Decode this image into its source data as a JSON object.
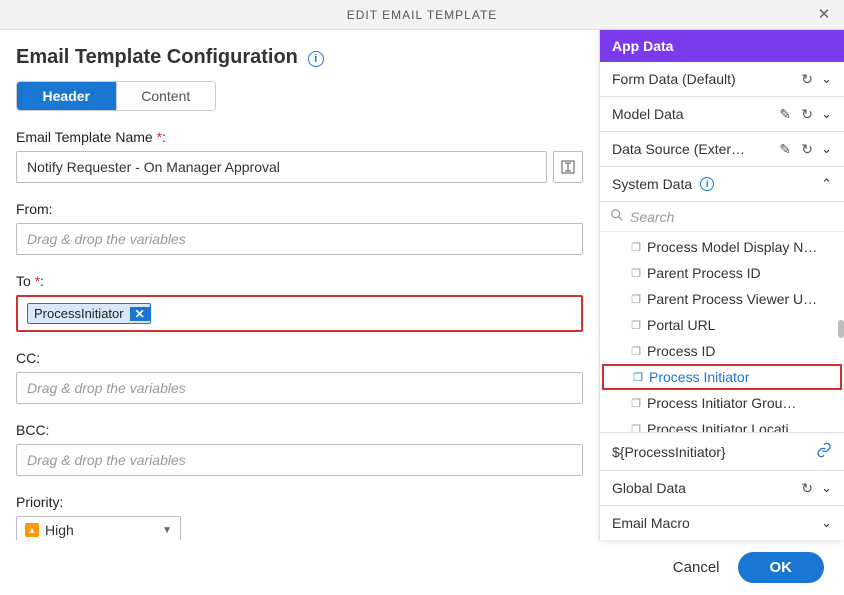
{
  "dialog": {
    "title": "EDIT EMAIL TEMPLATE"
  },
  "header": {
    "title": "Email Template Configuration"
  },
  "tabs": {
    "header": "Header",
    "content": "Content"
  },
  "fields": {
    "name_label": "Email Template Name",
    "name_value": "Notify Requester - On Manager Approval",
    "from_label": "From:",
    "from_placeholder": "Drag & drop the variables",
    "to_label": "To",
    "to_chip": "ProcessInitiator",
    "cc_label": "CC:",
    "cc_placeholder": "Drag & drop the variables",
    "bcc_label": "BCC:",
    "bcc_placeholder": "Drag & drop the variables",
    "priority_label": "Priority:",
    "priority_value": "High"
  },
  "panel": {
    "title": "App Data",
    "sections": {
      "form_data": "Form Data (Default)",
      "model_data": "Model Data",
      "data_source": "Data Source (Exter…",
      "system_data": "System Data",
      "global_data": "Global Data",
      "email_macro": "Email Macro"
    },
    "search_placeholder": "Search",
    "system_items": [
      "Process Model Display N…",
      "Parent Process ID",
      "Parent Process Viewer U…",
      "Portal URL",
      "Process ID",
      "Process Initiator",
      "Process Initiator Grou…",
      "Process Initiator Locati…"
    ],
    "expression": "${ProcessInitiator}"
  },
  "footer": {
    "cancel": "Cancel",
    "ok": "OK"
  }
}
